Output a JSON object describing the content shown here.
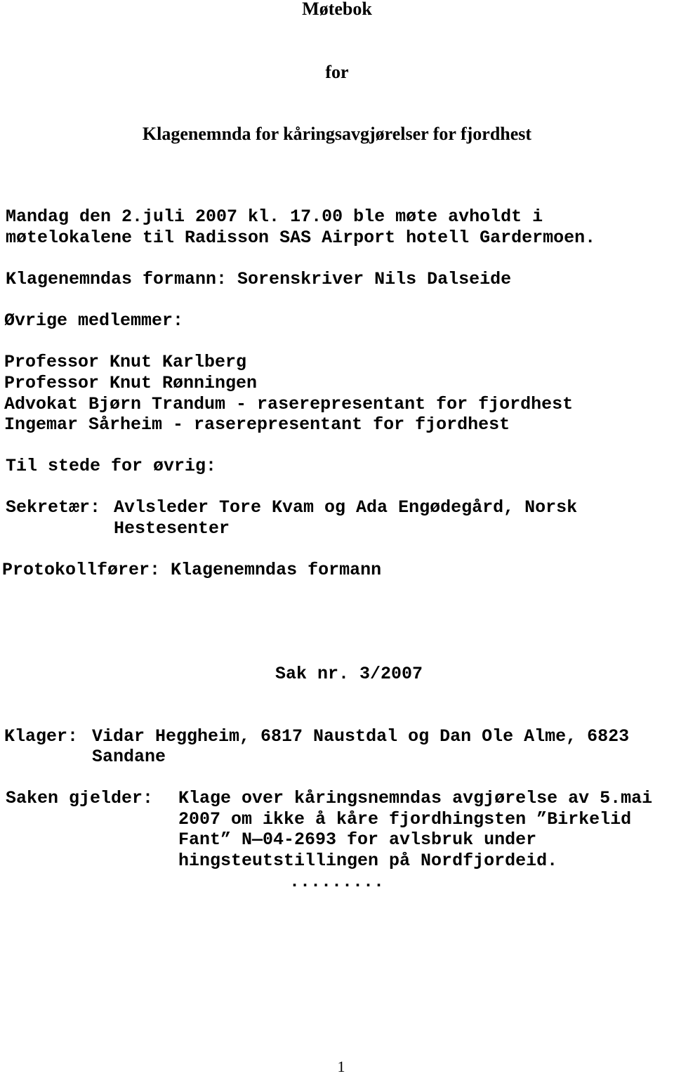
{
  "document": {
    "title_lines": [
      "Møtebok",
      "for",
      "Klagenemnda for kåringsavgjørelser for fjordhest"
    ],
    "meeting_lines": [
      "Mandag den 2.juli 2007 kl. 17.00 ble møte avholdt i",
      "møtelokalene til Radisson SAS Airport hotell Gardermoen."
    ],
    "chairman": "Klagenemndas formann: Sorenskriver Nils Dalseide",
    "other_members_label": "Øvrige medlemmer:",
    "members": [
      "Professor Knut Karlberg",
      "Professor Knut Rønningen",
      "Advokat Bjørn Trandum - raserepresentant for fjordhest",
      "Ingemar Sårheim - raserepresentant for fjordhest"
    ],
    "present_label": "Til stede for øvrig:",
    "secretary_label": "Sekretær:",
    "secretary_lines": [
      "Avlsleder Tore Kvam og Ada Engødegård, Norsk",
      "Hestesenter"
    ],
    "minutes_keeper": "Protokollfører: Klagenemndas formann",
    "case_number": "Sak nr. 3/2007",
    "complainant_label": "Klager:",
    "complainant_lines": [
      "Vidar Heggheim, 6817 Naustdal og Dan Ole Alme, 6823",
      "Sandane"
    ],
    "subject_label": "Saken gjelder:",
    "subject_lines": [
      "Klage over kåringsnemndas avgjørelse av 5.mai",
      "2007 om ikke å kåre fjordhingsten ”Birkelid",
      "Fant” N—04-2693 for avlsbruk under",
      "hingsteutstillingen på Nordfjordeid."
    ],
    "ellipsis": ".........",
    "page_number": "1"
  }
}
